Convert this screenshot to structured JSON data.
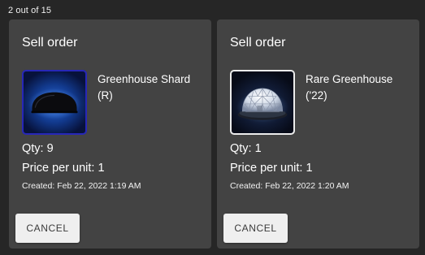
{
  "page": {
    "count_label": "2 out of 15"
  },
  "orders": [
    {
      "heading": "Sell order",
      "item_name": "Greenhouse Shard (R)",
      "thumbnail_icon": "dark-dome-shard-icon",
      "thumbnail_border_color": "#2727b8",
      "qty_text": "Qty: 9",
      "price_text": "Price per unit: 1",
      "created_text": "Created: Feb 22, 2022 1:19 AM",
      "cancel_label": "CANCEL"
    },
    {
      "heading": "Sell order",
      "item_name": "Rare Greenhouse ('22)",
      "thumbnail_icon": "geodesic-greenhouse-dome-icon",
      "thumbnail_border_color": "#ececec",
      "qty_text": "Qty: 1",
      "price_text": "Price per unit: 1",
      "created_text": "Created: Feb 22, 2022 1:20 AM",
      "cancel_label": "CANCEL"
    }
  ],
  "colors": {
    "page_background": "#262626",
    "card_background": "#434343",
    "button_background": "#efefef",
    "button_text": "#3a3a3a"
  }
}
